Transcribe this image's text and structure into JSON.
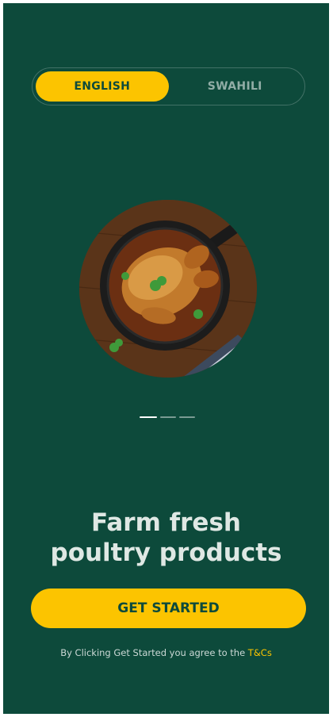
{
  "colors": {
    "background": "#0d4a3b",
    "accent": "#fcc400",
    "headline": "#dfe8e4"
  },
  "language_toggle": {
    "options": [
      {
        "label": "ENGLISH",
        "selected": true
      },
      {
        "label": "SWAHILI",
        "selected": false
      }
    ]
  },
  "hero": {
    "icon": "roast-chicken-image"
  },
  "carousel": {
    "page_count": 3,
    "current_page": 1
  },
  "headline": {
    "line1": "Farm fresh",
    "line2": "poultry products"
  },
  "cta": {
    "label": "GET STARTED"
  },
  "terms": {
    "text": "By Clicking Get Started you agree to the ",
    "link": "T&Cs"
  }
}
